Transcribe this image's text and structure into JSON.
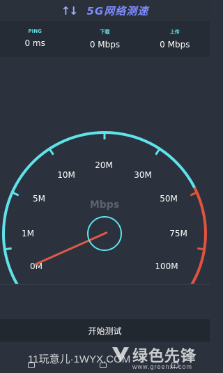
{
  "header": {
    "arrows_icon": "↑↓",
    "title": "5G网络测速"
  },
  "stats": [
    {
      "label": "PING",
      "value": "0 ms"
    },
    {
      "label": "下载",
      "value": "0 Mbps"
    },
    {
      "label": "上传",
      "value": "0 Mbps"
    }
  ],
  "gauge": {
    "unit": "Mbps",
    "tick_labels": [
      "0M",
      "1M",
      "5M",
      "10M",
      "20M",
      "30M",
      "50M",
      "75M",
      "100M"
    ],
    "current_speed_fraction": 0,
    "colors": {
      "arc": "#5fe3ea",
      "high_arc": "#e0533f",
      "needle": "#e05a46",
      "hub": "#5fe3ea"
    }
  },
  "actions": {
    "start_label": "开始测试"
  },
  "watermark": {
    "left_text": "11玩意儿·1WYX.COM",
    "right_text": "绿色先锋",
    "url": "www.greenxf.com"
  }
}
